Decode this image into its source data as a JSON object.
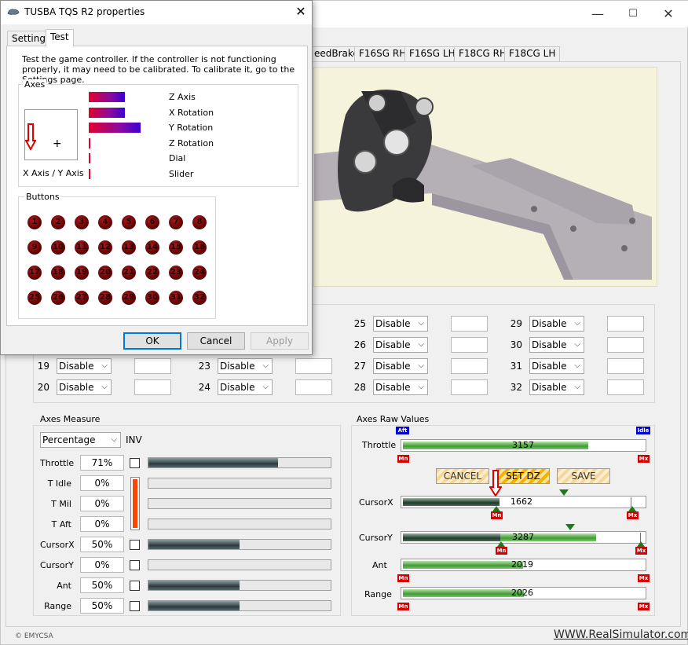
{
  "main_window": {
    "tabs": [
      "eedBrake",
      "F16SG RH",
      "F16SG LH",
      "F18CG RH",
      "F18CG LH"
    ],
    "button_map": {
      "rows": [
        [
          {
            "num": "",
            "value": ""
          },
          {
            "num": "",
            "value": ""
          },
          {
            "num": "25",
            "value": "Disable"
          },
          {
            "num": "29",
            "value": "Disable"
          }
        ],
        [
          {
            "num": "",
            "value": ""
          },
          {
            "num": "",
            "value": ""
          },
          {
            "num": "26",
            "value": "Disable"
          },
          {
            "num": "30",
            "value": "Disable"
          }
        ],
        [
          {
            "num": "19",
            "value": "Disable"
          },
          {
            "num": "23",
            "value": "Disable"
          },
          {
            "num": "27",
            "value": "Disable"
          },
          {
            "num": "31",
            "value": "Disable"
          }
        ],
        [
          {
            "num": "20",
            "value": "Disable"
          },
          {
            "num": "24",
            "value": "Disable"
          },
          {
            "num": "28",
            "value": "Disable"
          },
          {
            "num": "32",
            "value": "Disable"
          }
        ]
      ]
    },
    "axes_measure": {
      "title": "Axes Measure",
      "mode": "Percentage",
      "inv_label": "INV",
      "rows": [
        {
          "label": "Throttle",
          "value": "71%",
          "fill": 0.71
        },
        {
          "label": "T Idle",
          "value": "0%",
          "fill": 0
        },
        {
          "label": "T Mil",
          "value": "0%",
          "fill": 0
        },
        {
          "label": "T Aft",
          "value": "0%",
          "fill": 0
        },
        {
          "label": "CursorX",
          "value": "50%",
          "fill": 0.5
        },
        {
          "label": "CursorY",
          "value": "0%",
          "fill": 0
        },
        {
          "label": "Ant",
          "value": "50%",
          "fill": 0.5
        },
        {
          "label": "Range",
          "value": "50%",
          "fill": 0.5
        }
      ]
    },
    "axes_raw": {
      "title": "Axes Raw Values",
      "throttle": {
        "label": "Throttle",
        "value": "3157",
        "aft": "Aft",
        "idle": "Idle",
        "mn": "Mn",
        "mx": "Mx"
      },
      "buttons": {
        "cancel": "CANCEL",
        "set_dz": "SET DZ",
        "save": "SAVE"
      },
      "cursorx": {
        "label": "CursorX",
        "value": "1662",
        "mn": "Mn",
        "mx": "Mx"
      },
      "cursory": {
        "label": "CursorY",
        "value": "3287",
        "mn": "Mn",
        "mx": "Mx"
      },
      "ant": {
        "label": "Ant",
        "value": "2019",
        "mn": "Mn",
        "mx": "Mx"
      },
      "range": {
        "label": "Range",
        "value": "2026",
        "mn": "Mn",
        "mx": "Mx"
      }
    },
    "footer": {
      "copyright": "© EMYCSA",
      "link": "WWW.RealSimulator.com"
    },
    "title_buttons": {
      "minimize": "—",
      "maximize": "☐",
      "close": "✕"
    }
  },
  "dialog": {
    "title": "TUSBA TQS R2 properties",
    "close": "✕",
    "tabs": [
      "Settings",
      "Test"
    ],
    "intro": "Test the game controller.  If the controller is not functioning properly, it may need to be calibrated.  To calibrate it, go to the Settings page.",
    "axes_title": "Axes",
    "xy_label": "X Axis / Y Axis",
    "axes": [
      {
        "label": "Z Axis",
        "fill": 0.7
      },
      {
        "label": "X Rotation",
        "fill": 0.7
      },
      {
        "label": "Y Rotation",
        "fill": 1.0
      },
      {
        "label": "Z Rotation",
        "fill": 0
      },
      {
        "label": "Dial",
        "fill": 0
      },
      {
        "label": "Slider",
        "fill": 0
      }
    ],
    "buttons_title": "Buttons",
    "button_numbers": [
      "1",
      "2",
      "3",
      "4",
      "5",
      "6",
      "7",
      "8",
      "9",
      "10",
      "11",
      "12",
      "13",
      "14",
      "15",
      "16",
      "17",
      "18",
      "19",
      "20",
      "21",
      "22",
      "23",
      "24",
      "25",
      "26",
      "27",
      "28",
      "29",
      "30",
      "31",
      "32"
    ],
    "ok": "OK",
    "cancel": "Cancel",
    "apply": "Apply"
  },
  "colors": {
    "accent": "#0078d7",
    "axis_start": "#e4002b",
    "axis_end": "#3a00d4",
    "raw_green": "#3f9a36",
    "marker_red": "#d50000",
    "marker_blue": "#0000d0",
    "t_bar_orange": "#ff4500"
  }
}
